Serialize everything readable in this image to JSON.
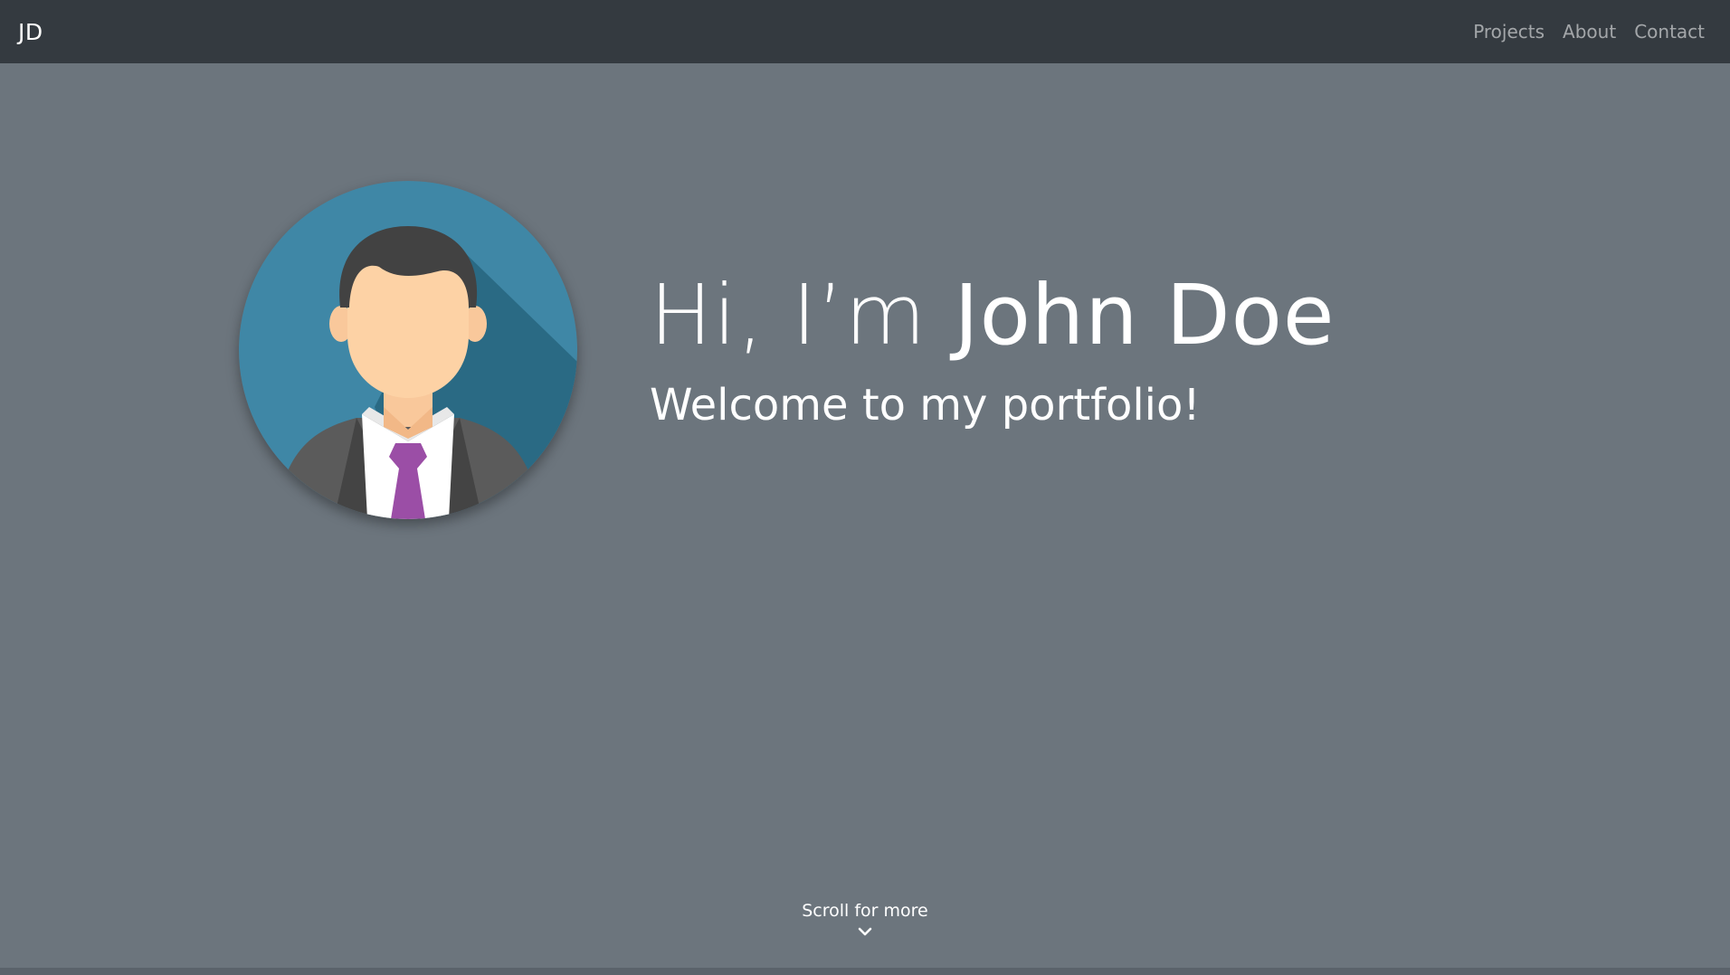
{
  "navbar": {
    "brand": "JD",
    "links": [
      "Projects",
      "About",
      "Contact"
    ]
  },
  "hero": {
    "title_greeting": "Hi, I’m",
    "title_name": "John Doe",
    "subtitle": "Welcome to my portfolio!",
    "avatar_icon": "businessman-avatar-icon"
  },
  "scroll_hint": {
    "label": "Scroll for more",
    "icon": "chevron-down-icon"
  },
  "colors": {
    "navbar_bg": "#343a40",
    "page_bg": "#6c757d",
    "avatar_bg": "#3f87a6",
    "tie": "#9b4ea6"
  }
}
